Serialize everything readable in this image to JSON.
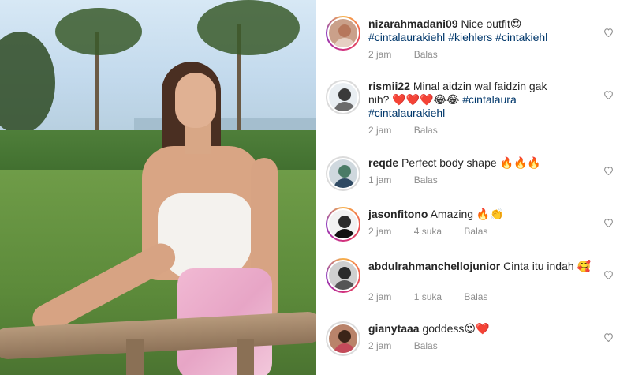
{
  "comments": [
    {
      "username": "nizarahmadani09",
      "text": "Nice outfit😍",
      "hashtags": [
        "#cintalaurakiehl",
        "#kiehlers",
        "#cintakiehl"
      ],
      "time": "2 jam",
      "likes": "",
      "reply_label": "Balas",
      "avatar_ring": "story",
      "avatar_colors": {
        "bg": "#caa08a",
        "head": "#b6775c",
        "body": "#e6d0c3"
      }
    },
    {
      "username": "rismii22",
      "text": "Minal aidzin wal faidzin gak nih? ❤️❤️❤️😂😂",
      "hashtags": [
        "#cintalaura",
        "#cintalaurakiehl"
      ],
      "time": "2 jam",
      "likes": "",
      "reply_label": "Balas",
      "avatar_ring": "plain",
      "avatar_colors": {
        "bg": "#e9eef2",
        "head": "#3a3a3a",
        "body": "#6b6b6b"
      }
    },
    {
      "username": "reqde",
      "text": "Perfect body shape 🔥🔥🔥",
      "hashtags": [],
      "time": "1 jam",
      "likes": "",
      "reply_label": "Balas",
      "avatar_ring": "plain",
      "avatar_colors": {
        "bg": "#cfd8de",
        "head": "#4a7b66",
        "body": "#2f4a63"
      }
    },
    {
      "username": "jasonfitono",
      "text": "Amazing 🔥👏",
      "hashtags": [],
      "time": "2 jam",
      "likes": "4 suka",
      "reply_label": "Balas",
      "avatar_ring": "story",
      "avatar_colors": {
        "bg": "#f2f2f2",
        "head": "#2b2b2b",
        "body": "#111111"
      }
    },
    {
      "username": "abdulrahmanchellojunior",
      "text": "Cinta itu indah 🥰",
      "hashtags": [],
      "time": "2 jam",
      "likes": "1 suka",
      "reply_label": "Balas",
      "avatar_ring": "story",
      "avatar_colors": {
        "bg": "#cfcfcf",
        "head": "#2a2a2a",
        "body": "#555555"
      }
    },
    {
      "username": "gianytaaa",
      "text": "goddess😍❤️",
      "hashtags": [],
      "time": "2 jam",
      "likes": "",
      "reply_label": "Balas",
      "avatar_ring": "plain",
      "avatar_colors": {
        "bg": "#b9836a",
        "head": "#3b2418",
        "body": "#c44a5a"
      }
    }
  ],
  "colors": {
    "username": "#262626",
    "hashtag": "#00376b",
    "meta": "#8e8e8e",
    "like_icon": "#8e8e8e"
  },
  "icons": {
    "like": "heart-outline-icon"
  }
}
